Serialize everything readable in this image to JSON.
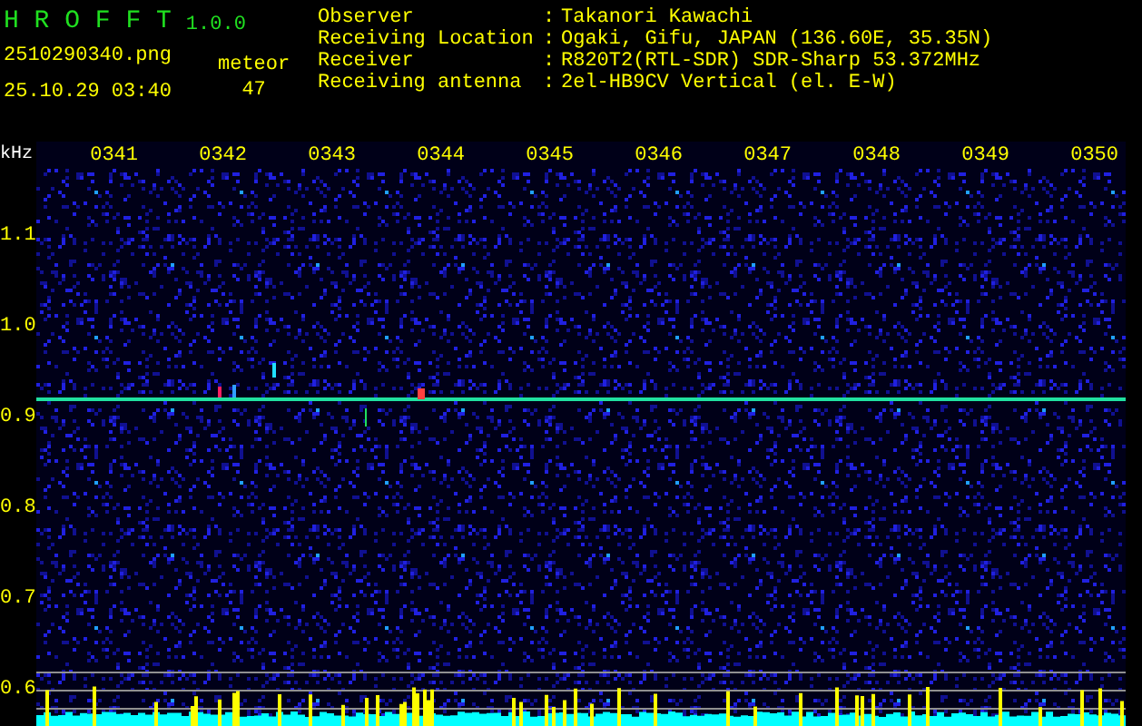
{
  "app": {
    "name": "H R O F F T",
    "version": "1.0.0"
  },
  "file": {
    "filename": "2510290340.png",
    "datetime": "25.10.29 03:40"
  },
  "meteor": {
    "label": "meteor",
    "count": "47"
  },
  "station": [
    {
      "label": "Observer",
      "separator": ":",
      "value": "Takanori Kawachi"
    },
    {
      "label": "Receiving Location",
      "separator": ":",
      "value": "Ogaki, Gifu, JAPAN (136.60E, 35.35N)"
    },
    {
      "label": "Receiver",
      "separator": ":",
      "value": "R820T2(RTL-SDR) SDR-Sharp 53.372MHz"
    },
    {
      "label": "Receiving antenna",
      "separator": ":",
      "value": "2el-HB9CV Vertical (el. E-W)"
    }
  ],
  "time_axis": {
    "ticks": [
      "0341",
      "0342",
      "0343",
      "0344",
      "0345",
      "0346",
      "0347",
      "0348",
      "0349",
      "0350"
    ]
  },
  "frequency_axis": {
    "unit": "kHz",
    "ticks": [
      "1.1",
      "1.0",
      "0.9",
      "0.8",
      "0.7",
      "0.6"
    ]
  }
}
